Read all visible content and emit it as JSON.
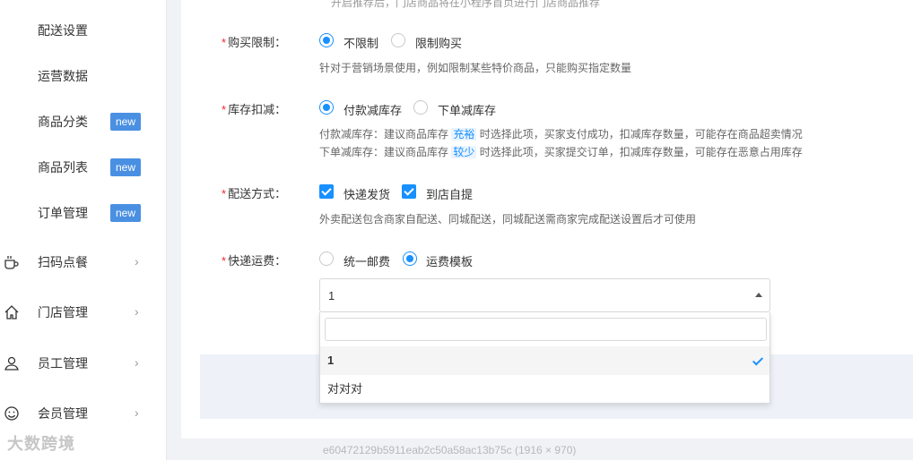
{
  "sidebar": {
    "items": [
      {
        "label": "配送设置"
      },
      {
        "label": "运营数据"
      },
      {
        "label": "商品分类",
        "badge": "new"
      },
      {
        "label": "商品列表",
        "badge": "new"
      },
      {
        "label": "订单管理",
        "badge": "new"
      },
      {
        "label": "扫码点餐",
        "icon": "coffee-cup-icon",
        "expand": "›"
      },
      {
        "label": "门店管理",
        "icon": "home-icon",
        "expand": "›"
      },
      {
        "label": "员工管理",
        "icon": "user-icon",
        "expand": "›"
      },
      {
        "label": "会员管理",
        "icon": "smile-icon",
        "expand": "›"
      }
    ]
  },
  "form": {
    "top_hint": "开启推荐后，门店商品将在小程序首页进行门店商品推荐",
    "purchase_limit": {
      "label": "购买限制：",
      "options": [
        "不限制",
        "限制购买"
      ],
      "selected": "不限制",
      "help": "针对于营销场景使用，例如限制某些特价商品，只能购买指定数量"
    },
    "stock_deduction": {
      "label": "库存扣减：",
      "options": [
        "付款减库存",
        "下单减库存"
      ],
      "selected": "付款减库存",
      "help1_a": "付款减库存：建议商品库存",
      "help1_hl": "充裕",
      "help1_b": "时选择此项，买家支付成功，扣减库存数量，可能存在商品超卖情况",
      "help2_a": "下单减库存：建议商品库存",
      "help2_hl": "较少",
      "help2_b": "时选择此项，买家提交订单，扣减库存数量，可能存在恶意占用库存"
    },
    "delivery": {
      "label": "配送方式：",
      "options": [
        "快递发货",
        "到店自提"
      ],
      "checked": [
        "快递发货",
        "到店自提"
      ],
      "help": "外卖配送包含商家自配送、同城配送，同城配送需商家完成配送设置后才可使用"
    },
    "shipping_fee": {
      "label": "快递运费：",
      "options": [
        "统一邮费",
        "运费模板"
      ],
      "selected": "运费模板",
      "select_value": "1",
      "search_value": "",
      "dropdown_options": [
        "1",
        "对对对"
      ],
      "dropdown_selected": "1"
    },
    "required_mark": "*"
  },
  "watermark": {
    "id_text": "e60472129b5911eab2c50a58ac13b75c (1916 × 970)",
    "logo_text": "大数跨境"
  }
}
